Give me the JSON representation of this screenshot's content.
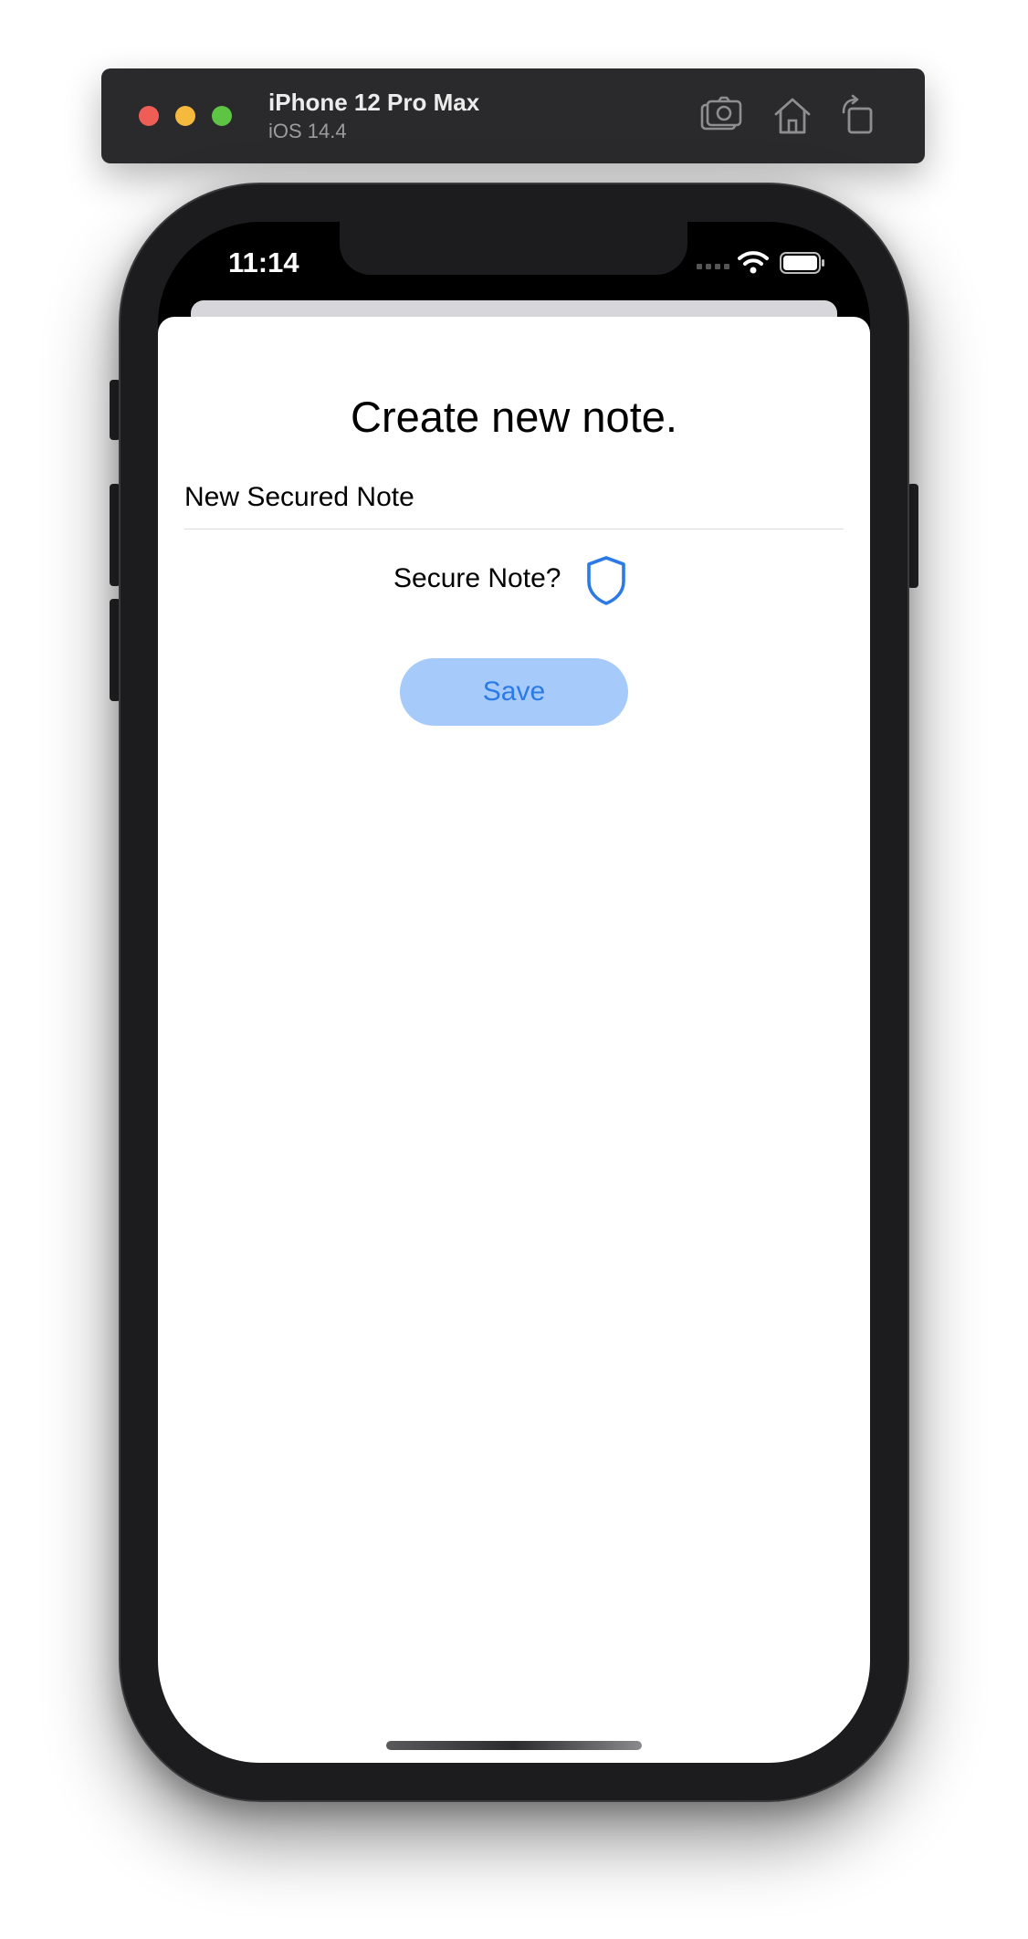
{
  "simulator": {
    "device_name": "iPhone 12 Pro Max",
    "os_version": "iOS 14.4",
    "toolbar_icons": [
      "screenshot-icon",
      "home-icon",
      "rotate-icon"
    ]
  },
  "status_bar": {
    "time": "11:14",
    "icons": [
      "cellular-signal-icon",
      "wifi-icon",
      "battery-icon"
    ]
  },
  "screen": {
    "title": "Create new note.",
    "note_field": {
      "value": "New Secured Note",
      "placeholder": ""
    },
    "secure_label": "Secure Note?",
    "secure_icon": "shield-icon",
    "save_label": "Save"
  },
  "colors": {
    "accent": "#2b7ae6",
    "save_background": "#a6cbfa",
    "shield_stroke": "#2b7ae6"
  }
}
